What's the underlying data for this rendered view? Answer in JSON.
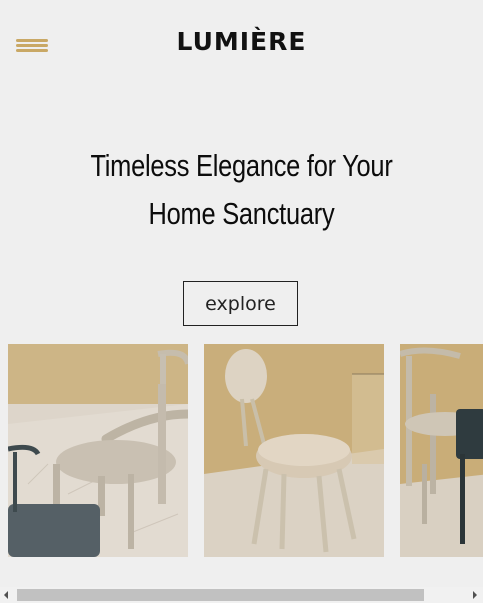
{
  "header": {
    "brand": "LUMIÈRE",
    "menu_icon": "hamburger-menu-icon"
  },
  "hero": {
    "title": "Timeless Elegance for Your Home Sanctuary",
    "cta_label": "explore"
  },
  "gallery": {
    "items": [
      {
        "name": "beige-metal-chairs-photo"
      },
      {
        "name": "round-cushioned-chair-photo"
      },
      {
        "name": "metal-chairs-with-green-seat-photo"
      }
    ]
  },
  "colors": {
    "accent": "#c9a865",
    "background": "#efefef",
    "text": "#111111"
  }
}
